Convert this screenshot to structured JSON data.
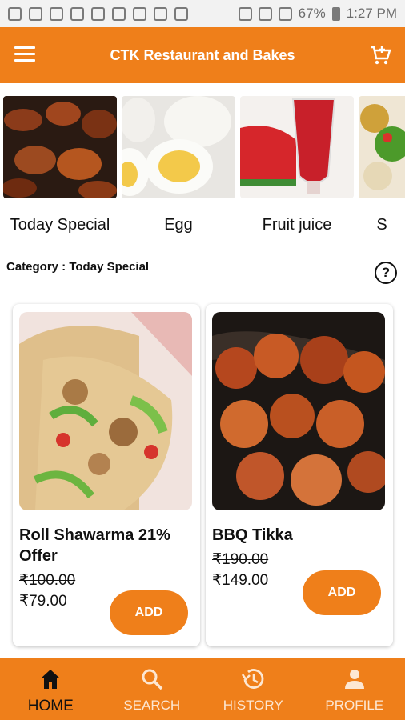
{
  "status_bar": {
    "battery": "67%",
    "time": "1:27 PM"
  },
  "app_bar": {
    "title": "CTK Restaurant and Bakes",
    "menu_icon": "hamburger-menu-icon",
    "cart_icon": "cart-add-icon"
  },
  "categories": [
    {
      "label": "Today Special"
    },
    {
      "label": "Egg"
    },
    {
      "label": "Fruit juice"
    },
    {
      "label": "S"
    }
  ],
  "category_heading": "Category : Today Special",
  "help_icon": "help-circle-icon",
  "products": [
    {
      "name": "Roll Shawarma 21% Offer",
      "old_price": "₹100.00",
      "new_price": "₹79.00",
      "add_label": "ADD"
    },
    {
      "name": "BBQ Tikka",
      "old_price": "₹190.00",
      "new_price": "₹149.00",
      "add_label": "ADD"
    }
  ],
  "bottom_nav": [
    {
      "label": "HOME",
      "icon": "home-icon",
      "active": true
    },
    {
      "label": "SEARCH",
      "icon": "search-icon",
      "active": false
    },
    {
      "label": "HISTORY",
      "icon": "history-icon",
      "active": false
    },
    {
      "label": "PROFILE",
      "icon": "profile-icon",
      "active": false
    }
  ],
  "colors": {
    "accent": "#ef7f1a",
    "text": "#111111"
  }
}
